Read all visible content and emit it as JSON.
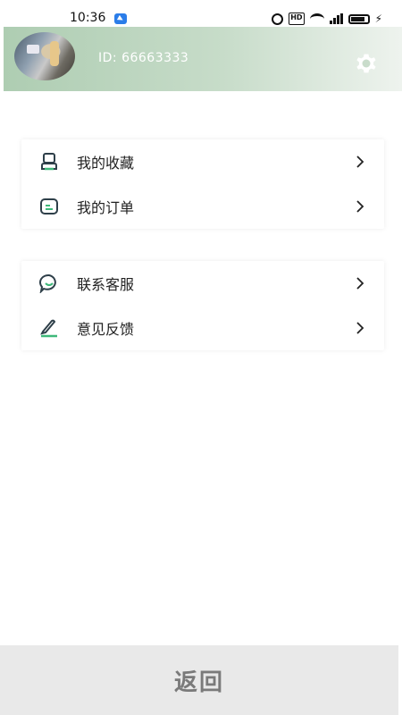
{
  "status_bar": {
    "time": "10:36",
    "indicators": [
      "alarm-icon",
      "hd-icon",
      "wifi-icon",
      "5g-signal-icon",
      "battery-icon",
      "charging-icon"
    ]
  },
  "header": {
    "user_id": "ID: 66663333",
    "avatar": "avatar",
    "settings_icon": "gear-icon",
    "gradient_start": "#aecdb2",
    "gradient_end": "#eef3ee"
  },
  "menu_group_1": [
    {
      "label": "我的收藏",
      "icon": "favorites-icon"
    },
    {
      "label": "我的订单",
      "icon": "order-icon"
    }
  ],
  "menu_group_2": [
    {
      "label": "联系客服",
      "icon": "chat-icon"
    },
    {
      "label": "意见反馈",
      "icon": "feedback-pen-icon"
    }
  ],
  "bottom": {
    "back_label": "返回"
  },
  "colors": {
    "accent": "#2d6e5a",
    "back_bar": "#e9e9e9"
  }
}
